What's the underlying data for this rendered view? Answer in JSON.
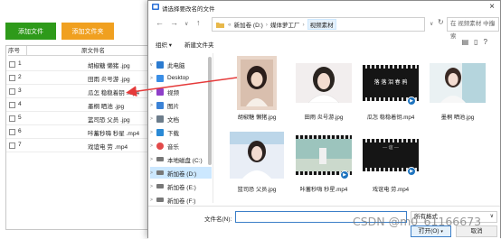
{
  "app": {
    "add_file_label": "添加文件",
    "add_folder_label": "添加文件夹",
    "colors": {
      "add_file": "#2e9a1a",
      "add_folder": "#f0a020"
    },
    "table": {
      "headers": [
        "序号",
        "原文件名"
      ],
      "rows": [
        {
          "index": "1",
          "name": "胡椒糖 懒猪 .jpg"
        },
        {
          "index": "2",
          "name": "田雨  炎号游 .jpg"
        },
        {
          "index": "3",
          "name": "瓜怎 稳稳着钥 .mp4"
        },
        {
          "index": "4",
          "name": "墨桐  晒池 .jpg"
        },
        {
          "index": "5",
          "name": "篮司恐   父员 .jpg"
        },
        {
          "index": "6",
          "name": "咔蓄秒嗨 秒星 .mp4"
        },
        {
          "index": "7",
          "name": "戏谊电  劳 .mp4"
        }
      ]
    }
  },
  "dialog": {
    "title": "请选择要改名的文件",
    "close_icon": "close-icon",
    "address": [
      "«",
      "新加卷 (D:)",
      "媒体萝工厂",
      "视频素材"
    ],
    "search_placeholder": "在 视频素材 中搜索",
    "organize_label": "组织 ▾",
    "new_folder_label": "新建文件夹",
    "nav_items": [
      {
        "label": "此电脑",
        "icon": "computer-icon",
        "color": "#2b7bd0"
      },
      {
        "label": "Desktop",
        "icon": "desktop-icon",
        "color": "#3a8ee6"
      },
      {
        "label": "视频",
        "icon": "video-folder-icon",
        "color": "#8f3fc9"
      },
      {
        "label": "图片",
        "icon": "pictures-folder-icon",
        "color": "#3b82d6"
      },
      {
        "label": "文档",
        "icon": "documents-folder-icon",
        "color": "#6d7d8b"
      },
      {
        "label": "下载",
        "icon": "download-folder-icon",
        "color": "#2a8ad6"
      },
      {
        "label": "音乐",
        "icon": "music-folder-icon",
        "color": "#e24a4a"
      },
      {
        "label": "本地磁盘 (C:)",
        "icon": "drive-icon",
        "color": "#777777"
      },
      {
        "label": "新加卷 (D:)",
        "icon": "drive-icon",
        "color": "#777777",
        "selected": true
      },
      {
        "label": "新加卷 (E:)",
        "icon": "drive-icon",
        "color": "#777777"
      },
      {
        "label": "新加卷 (F:)",
        "icon": "drive-icon",
        "color": "#777777"
      }
    ],
    "files": [
      {
        "label": "胡椒糖 懒猪.jpg",
        "kind": "photo",
        "colors": [
          "#e9d6c9",
          "#2b1e1b"
        ]
      },
      {
        "label": "田雨  炎号游.jpg",
        "kind": "photo",
        "colors": [
          "#f2eeee",
          "#2a2420"
        ]
      },
      {
        "label": "瓜怎 稳稳着钥.mp4",
        "kind": "video",
        "frame_text": "落 落 泪 春 鸦",
        "colors": [
          "#1a1a1a",
          "#dddddd"
        ]
      },
      {
        "label": "墨桐  晒池.jpg",
        "kind": "photo",
        "colors": [
          "#eaf1f3",
          "#b5d5dd"
        ]
      },
      {
        "label": "篮司恐  父员.jpg",
        "kind": "photo",
        "colors": [
          "#e9eef6",
          "#bcd6e9"
        ]
      },
      {
        "label": "咔蓄秒嗨 秒星.mp4",
        "kind": "video",
        "colors": [
          "#6fa7a6",
          "#cbd9cc"
        ]
      },
      {
        "label": "戏谊电  劳.mp4",
        "kind": "video",
        "frame_text": "— 谊 —",
        "colors": [
          "#1a1a1a",
          "#bbbbbb"
        ]
      }
    ],
    "filename_label": "文件名(N):",
    "filename_value": "",
    "filetype_label": "所有格式",
    "open_label": "打开(O)",
    "cancel_label": "取消"
  },
  "watermark": "CSDN @m0_61166673"
}
